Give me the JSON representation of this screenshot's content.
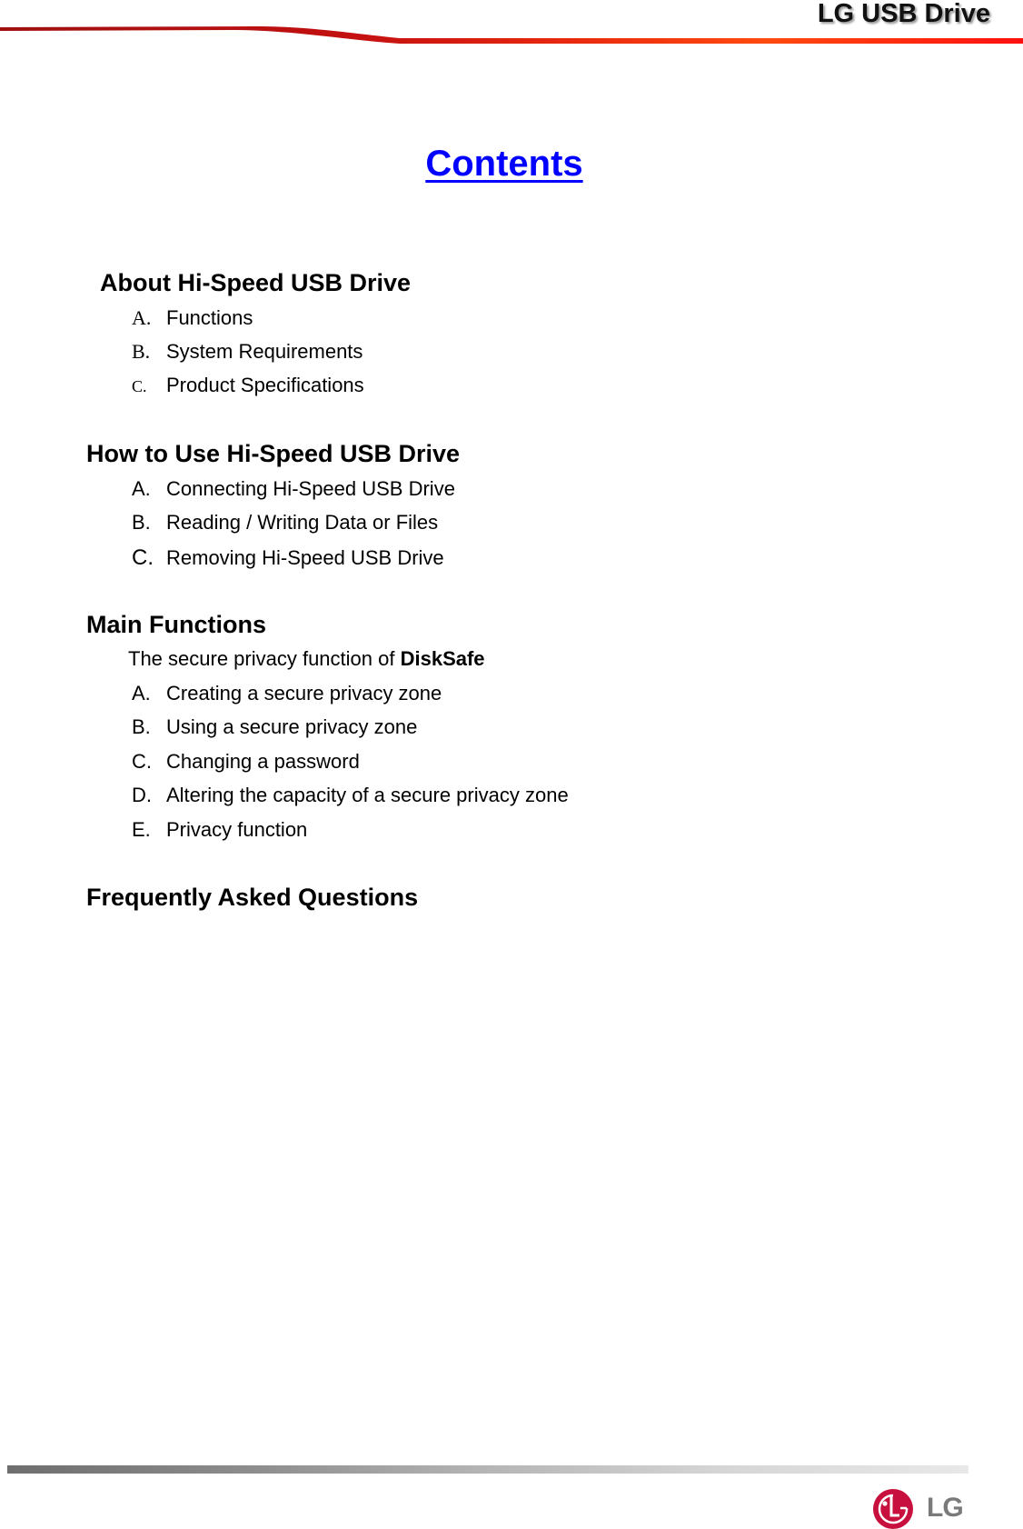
{
  "header": {
    "title": "LG USB Drive",
    "accent_color": "#e0201a"
  },
  "page_title": "Contents",
  "sections": [
    {
      "heading": "About Hi-Speed USB Drive",
      "items": [
        {
          "marker": "A.",
          "label": "Functions"
        },
        {
          "marker": "B.",
          "label": "System Requirements"
        },
        {
          "marker": "C.",
          "label": "Product Specifications"
        }
      ]
    },
    {
      "heading": "How to Use Hi-Speed USB Drive",
      "items": [
        {
          "marker": "A.",
          "label": "Connecting Hi-Speed USB Drive"
        },
        {
          "marker": "B.",
          "label": "Reading / Writing Data or Files"
        },
        {
          "marker": "C.",
          "label": "Removing Hi-Speed USB Drive"
        }
      ]
    },
    {
      "heading": "Main Functions",
      "intro_prefix": "The secure privacy function of ",
      "intro_bold": "DiskSafe",
      "items": [
        {
          "marker": "A.",
          "label": "Creating a secure privacy zone"
        },
        {
          "marker": "B.",
          "label": "Using a secure privacy zone"
        },
        {
          "marker": "C.",
          "label": "Changing a password"
        },
        {
          "marker": "D.",
          "label": "Altering the capacity of a secure privacy zone"
        },
        {
          "marker": "E.",
          "label": "Privacy function"
        }
      ]
    },
    {
      "heading": "Frequently Asked Questions",
      "items": []
    }
  ],
  "footer": {
    "logo_text": "LG",
    "logo_color": "#c8103e"
  }
}
